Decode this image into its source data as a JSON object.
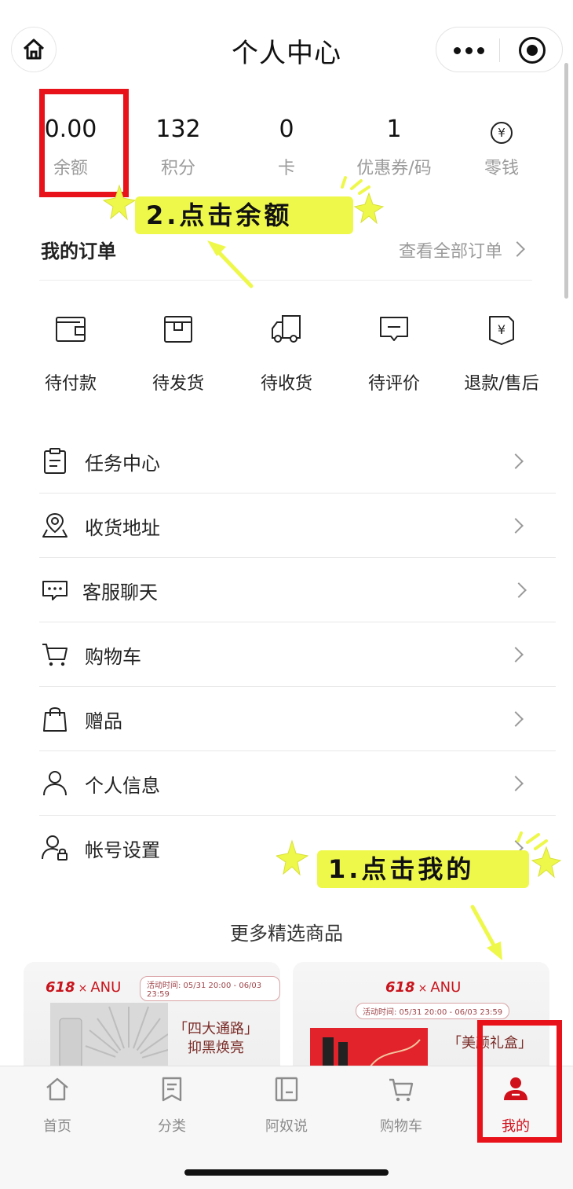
{
  "header": {
    "title": "个人中心"
  },
  "stats": [
    {
      "value": "0.00",
      "label": "余额"
    },
    {
      "value": "132",
      "label": "积分"
    },
    {
      "value": "0",
      "label": "卡"
    },
    {
      "value": "1",
      "label": "优惠券/码"
    },
    {
      "value": "¥",
      "label": "零钱"
    }
  ],
  "orders": {
    "title": "我的订单",
    "view_all": "查看全部订单",
    "items": [
      {
        "label": "待付款",
        "icon": "wallet-icon"
      },
      {
        "label": "待发货",
        "icon": "box-icon"
      },
      {
        "label": "待收货",
        "icon": "truck-icon"
      },
      {
        "label": "待评价",
        "icon": "comment-icon"
      },
      {
        "label": "退款/售后",
        "icon": "refund-icon"
      }
    ]
  },
  "menu": [
    {
      "label": "任务中心",
      "icon": "clipboard-icon"
    },
    {
      "label": "收货地址",
      "icon": "location-icon"
    },
    {
      "label": "客服聊天",
      "icon": "chat-icon"
    },
    {
      "label": "购物车",
      "icon": "cart-icon"
    },
    {
      "label": "赠品",
      "icon": "gift-bag-icon"
    },
    {
      "label": "个人信息",
      "icon": "user-icon"
    },
    {
      "label": "帐号设置",
      "icon": "user-settings-icon"
    }
  ],
  "more": {
    "title": "更多精选商品",
    "cards": [
      {
        "brand": "618",
        "x": "×",
        "partner": "ANU",
        "time": "活动时间: 05/31  20:00 - 06/03 23:59",
        "promo_line1": "「四大通路」",
        "promo_line2": "抑黑焕亮"
      },
      {
        "brand": "618",
        "x": "×",
        "partner": "ANU",
        "time": "活动时间: 05/31  20:00 - 06/03 23:59",
        "promo_line1": "「美颜礼盒」",
        "promo_line2": ""
      }
    ]
  },
  "tabbar": [
    {
      "label": "首页",
      "icon": "home-icon",
      "active": false
    },
    {
      "label": "分类",
      "icon": "bookmark-icon",
      "active": false
    },
    {
      "label": "阿奴说",
      "icon": "notebook-icon",
      "active": false
    },
    {
      "label": "购物车",
      "icon": "cart-icon",
      "active": false
    },
    {
      "label": "我的",
      "icon": "profile-icon",
      "active": true
    }
  ],
  "annotations": {
    "step2": "2.点击余额",
    "step1": "1.点击我的"
  },
  "colors": {
    "accent": "#d0101b",
    "annotation_box": "#e8121a",
    "highlighter": "#eef84a"
  }
}
